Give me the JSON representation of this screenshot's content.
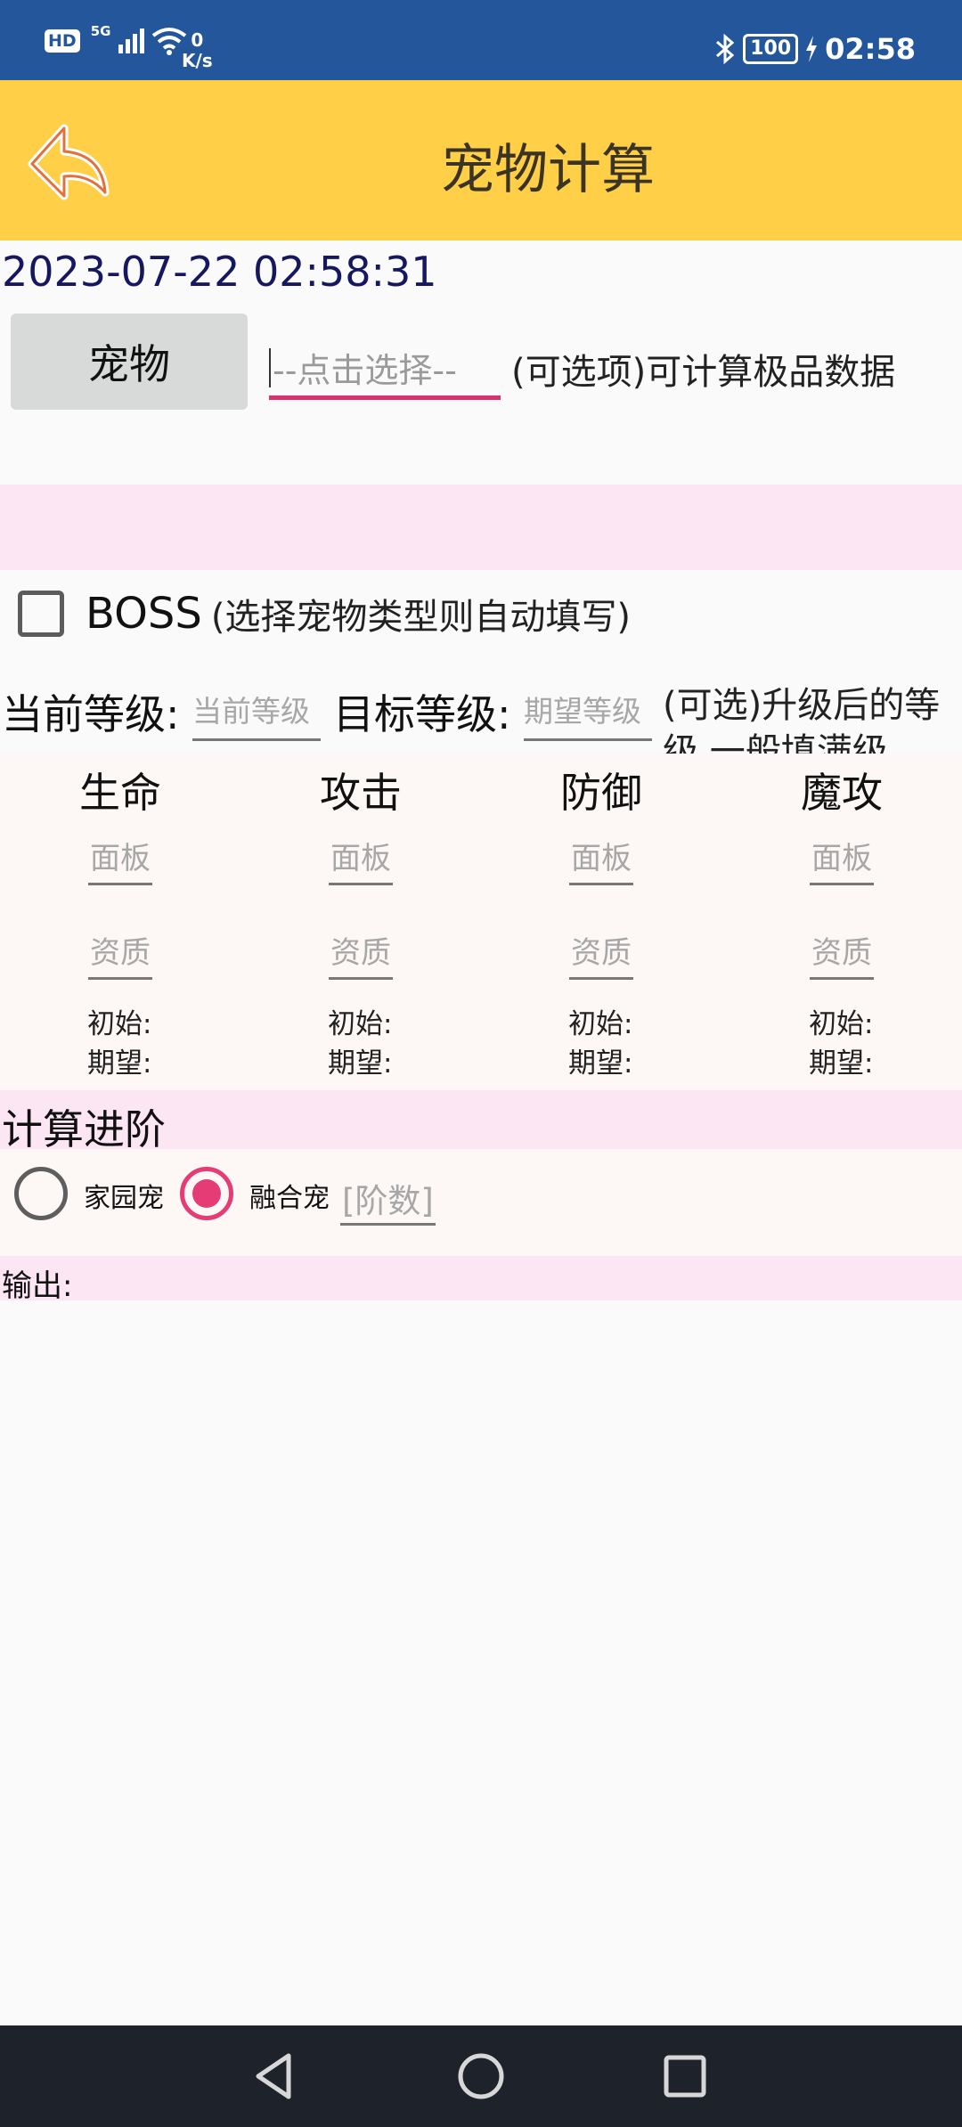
{
  "status_bar": {
    "network": "HD",
    "signal_tag": "5G",
    "speed_value": "0",
    "speed_unit": "K/s",
    "battery": "100",
    "time": "02:58"
  },
  "header": {
    "title": "宠物计算"
  },
  "datetime": "2023-07-22 02:58:31",
  "pet_selector": {
    "button_label": "宠物",
    "placeholder": "--点击选择--",
    "hint": "(可选项)可计算极品数据"
  },
  "boss": {
    "label": "BOSS",
    "hint": "(选择宠物类型则自动填写)",
    "checked": false
  },
  "levels": {
    "current_label": "当前等级:",
    "current_placeholder": "当前等级",
    "target_label": "目标等级:",
    "target_placeholder": "期望等级",
    "hint": "(可选)升级后的等级,一般填满级"
  },
  "stats": [
    {
      "name": "生命",
      "panel": "面板",
      "quality": "资质",
      "initial": "初始:",
      "expected": "期望:"
    },
    {
      "name": "攻击",
      "panel": "面板",
      "quality": "资质",
      "initial": "初始:",
      "expected": "期望:"
    },
    {
      "name": "防御",
      "panel": "面板",
      "quality": "资质",
      "initial": "初始:",
      "expected": "期望:"
    },
    {
      "name": "魔攻",
      "panel": "面板",
      "quality": "资质",
      "initial": "初始:",
      "expected": "期望:"
    }
  ],
  "advance": {
    "title": "计算进阶",
    "options": [
      {
        "label": "家园宠",
        "selected": false
      },
      {
        "label": "融合宠",
        "selected": true
      }
    ],
    "tier_placeholder": "[阶数]"
  },
  "output": {
    "label": "输出:"
  },
  "colors": {
    "status_bar": "#23569b",
    "header": "#fecf47",
    "accent": "#e63c76",
    "band": "#fce6f3"
  }
}
